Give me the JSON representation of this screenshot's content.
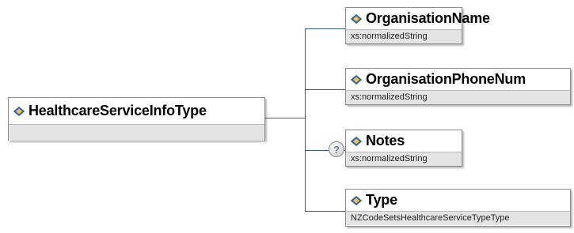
{
  "root": {
    "name": "HealthcareServiceInfoType",
    "type": ""
  },
  "children": [
    {
      "name": "OrganisationName",
      "type": "xs:normalizedString",
      "optional": false
    },
    {
      "name": "OrganisationPhoneNum",
      "type": "xs:normalizedString",
      "optional": false
    },
    {
      "name": "Notes",
      "type": "xs:normalizedString",
      "optional": true
    },
    {
      "name": "Type",
      "type": "NZCodeSetsHealthcareServiceTypeType",
      "optional": false
    }
  ],
  "optional_symbol": "?",
  "colors": {
    "connector": "#2f5f8a",
    "diamond_fill": "#2f6db0",
    "diamond_highlight": "#f2c14e",
    "type_band": "#e4e4e4",
    "border": "#8c8c8c"
  }
}
